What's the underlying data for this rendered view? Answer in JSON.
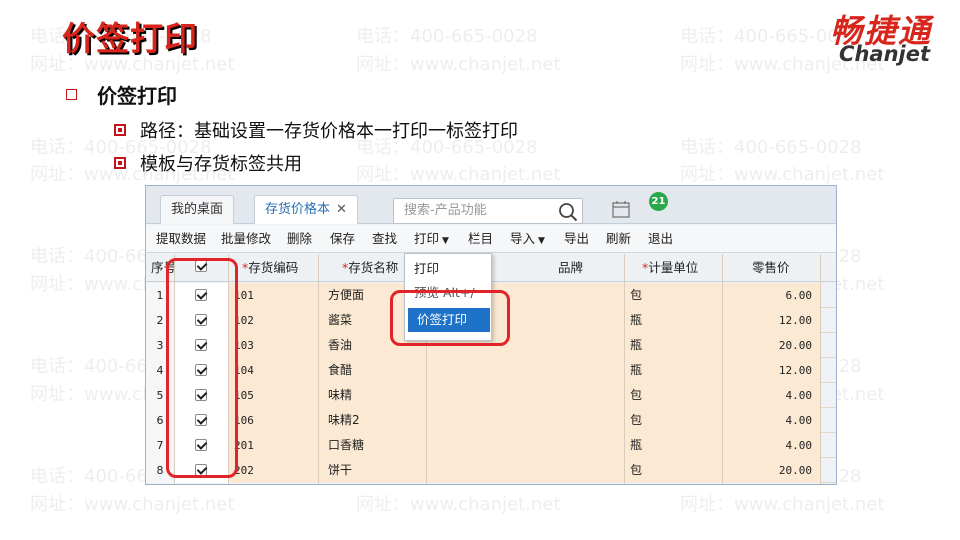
{
  "slide": {
    "title": "价签打印",
    "logo_cn": "畅捷通",
    "logo_en": "Chanjet",
    "bullet_main": "价签打印",
    "bullet_path": "路径：基础设置一存货价格本一打印一标签打印",
    "bullet_template": "模板与存货标签共用"
  },
  "watermark": {
    "phone": "电话：400-665-0028",
    "site": "网址：www.chanjet.net"
  },
  "app": {
    "tabs": [
      {
        "label": "我的桌面"
      },
      {
        "label": "存货价格本",
        "close": "✕"
      }
    ],
    "search_placeholder": "搜索-产品功能",
    "badge": "21",
    "toolbar": {
      "fetch": "提取数据",
      "batch_edit": "批量修改",
      "delete": "删除",
      "save": "保存",
      "find": "查找",
      "print": "打印",
      "columns": "栏目",
      "import": "导入",
      "export": "导出",
      "refresh": "刷新",
      "exit": "退出"
    },
    "columns": {
      "seq": "序号",
      "code": "存货编码",
      "name": "存货名称",
      "brand": "品牌",
      "unit": "计量单位",
      "price": "零售价",
      "required_mark": "*"
    },
    "rows": [
      {
        "seq": "1",
        "code": "101",
        "name": "方便面",
        "unit": "包",
        "price": "6.00"
      },
      {
        "seq": "2",
        "code": "102",
        "name": "酱菜",
        "unit": "瓶",
        "price": "12.00"
      },
      {
        "seq": "3",
        "code": "103",
        "name": "香油",
        "unit": "瓶",
        "price": "20.00"
      },
      {
        "seq": "4",
        "code": "104",
        "name": "食醋",
        "unit": "瓶",
        "price": "12.00"
      },
      {
        "seq": "5",
        "code": "105",
        "name": "味精",
        "unit": "包",
        "price": "4.00"
      },
      {
        "seq": "6",
        "code": "106",
        "name": "味精2",
        "unit": "包",
        "price": "4.00"
      },
      {
        "seq": "7",
        "code": "201",
        "name": "口香糖",
        "unit": "瓶",
        "price": "4.00"
      },
      {
        "seq": "8",
        "code": "202",
        "name": "饼干",
        "unit": "包",
        "price": "20.00"
      }
    ],
    "print_menu": {
      "print": "打印",
      "preview": "预览 Alt+/",
      "price_label_print": "价签打印"
    }
  }
}
